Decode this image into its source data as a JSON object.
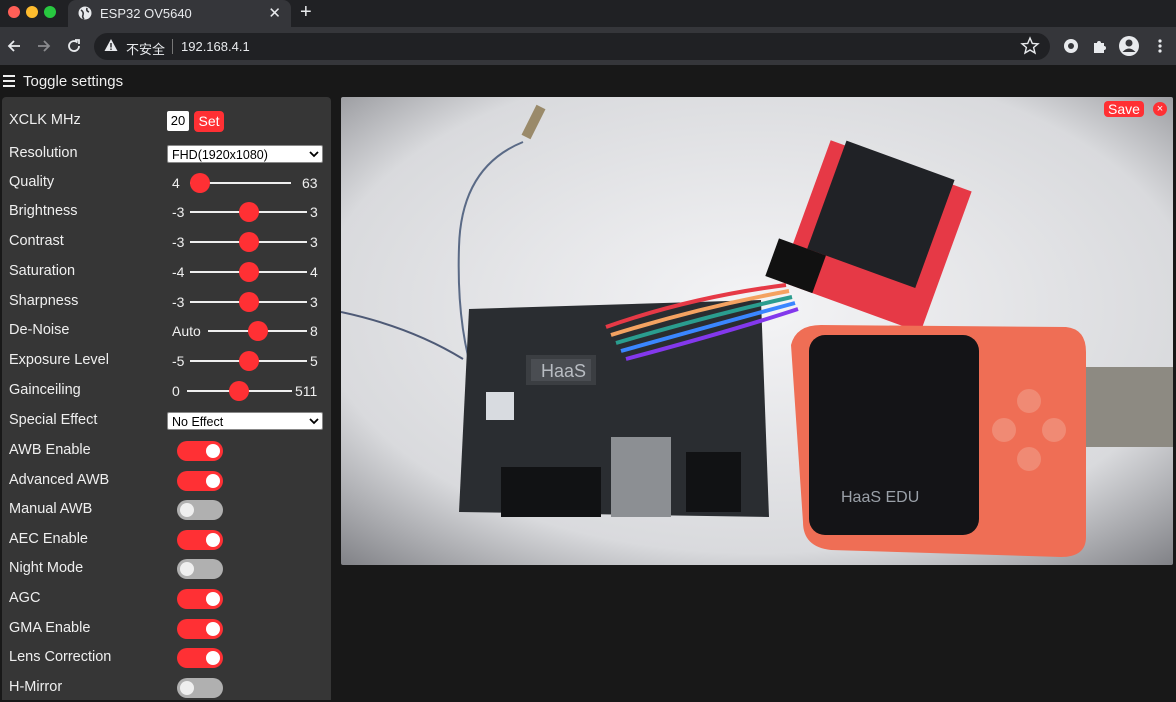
{
  "browser": {
    "tab_title": "ESP32 OV5640",
    "security_label": "不安全",
    "url": "192.168.4.1",
    "traffic_colors": [
      "#ff5f57",
      "#febc2e",
      "#28c840"
    ]
  },
  "page": {
    "toggle_label": "Toggle settings",
    "accent_color": "#ff3034"
  },
  "settings": {
    "xclk": {
      "label": "XCLK MHz",
      "value": "20",
      "button": "Set"
    },
    "resolution": {
      "label": "Resolution",
      "value": "FHD(1920x1080)"
    },
    "quality": {
      "label": "Quality",
      "min": "4",
      "max": "63",
      "value": 10
    },
    "brightness": {
      "label": "Brightness",
      "min": "-3",
      "max": "3",
      "value": 0
    },
    "contrast": {
      "label": "Contrast",
      "min": "-3",
      "max": "3",
      "value": 0
    },
    "saturation": {
      "label": "Saturation",
      "min": "-4",
      "max": "4",
      "value": 0
    },
    "sharpness": {
      "label": "Sharpness",
      "min": "-3",
      "max": "3",
      "value": 0
    },
    "denoise": {
      "label": "De-Noise",
      "min": "Auto",
      "max": "8",
      "value": 0.5
    },
    "exposure": {
      "label": "Exposure Level",
      "min": "-5",
      "max": "5",
      "value": 0
    },
    "gainceiling": {
      "label": "Gainceiling",
      "min": "0",
      "max": "511",
      "value": 255
    },
    "special_effect": {
      "label": "Special Effect",
      "value": "No Effect"
    },
    "toggles": [
      {
        "label": "AWB Enable",
        "on": true
      },
      {
        "label": "Advanced AWB",
        "on": true
      },
      {
        "label": "Manual AWB",
        "on": false
      },
      {
        "label": "AEC Enable",
        "on": true
      },
      {
        "label": "Night Mode",
        "on": false
      },
      {
        "label": "AGC",
        "on": true
      },
      {
        "label": "GMA Enable",
        "on": true
      },
      {
        "label": "Lens Correction",
        "on": true
      },
      {
        "label": "H-Mirror",
        "on": false
      }
    ]
  },
  "stream": {
    "save_label": "Save",
    "close_label": "×",
    "board_label": "HaaS",
    "device_label": "HaaS EDU"
  }
}
